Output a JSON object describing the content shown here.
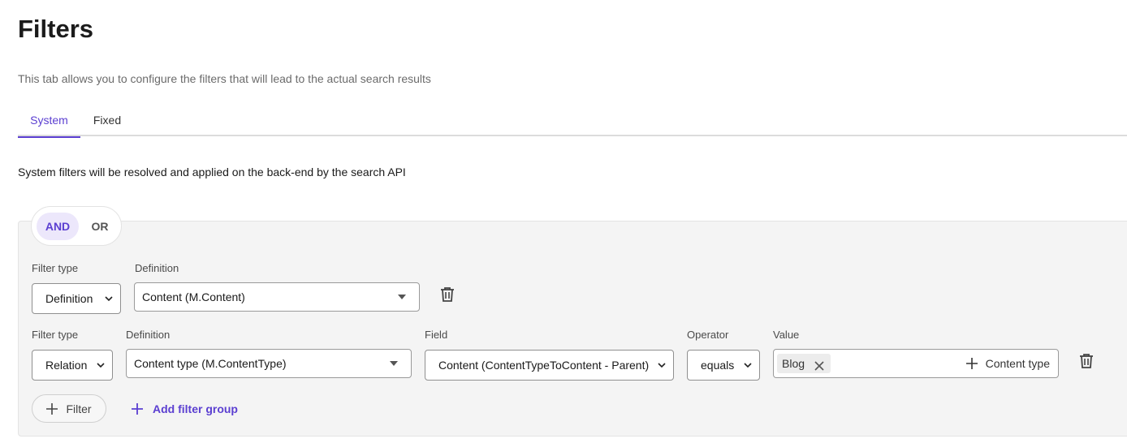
{
  "page": {
    "title": "Filters",
    "subtitle": "This tab allows you to configure the filters that will lead to the actual search results"
  },
  "tabs": [
    {
      "label": "System",
      "active": true
    },
    {
      "label": "Fixed",
      "active": false
    }
  ],
  "system_note": "System filters will be resolved and applied on the back-end by the search API",
  "logic": {
    "and_label": "AND",
    "or_label": "OR",
    "selected": "AND"
  },
  "rows": [
    {
      "filter_type_label": "Filter type",
      "filter_type_value": "Definition",
      "definition_label": "Definition",
      "definition_value": "Content (M.Content)"
    },
    {
      "filter_type_label": "Filter type",
      "filter_type_value": "Relation",
      "definition_label": "Definition",
      "definition_value": "Content type (M.ContentType)",
      "field_label": "Field",
      "field_value": "Content (ContentTypeToContent - Parent)",
      "operator_label": "Operator",
      "operator_value": "equals",
      "value_label": "Value",
      "value_chip": "Blog",
      "add_value_label": "Content type"
    }
  ],
  "actions": {
    "filter_label": "Filter",
    "add_group_label": "Add filter group"
  },
  "colors": {
    "accent": "#5b3fd1",
    "panel_bg": "#f4f4f4"
  }
}
